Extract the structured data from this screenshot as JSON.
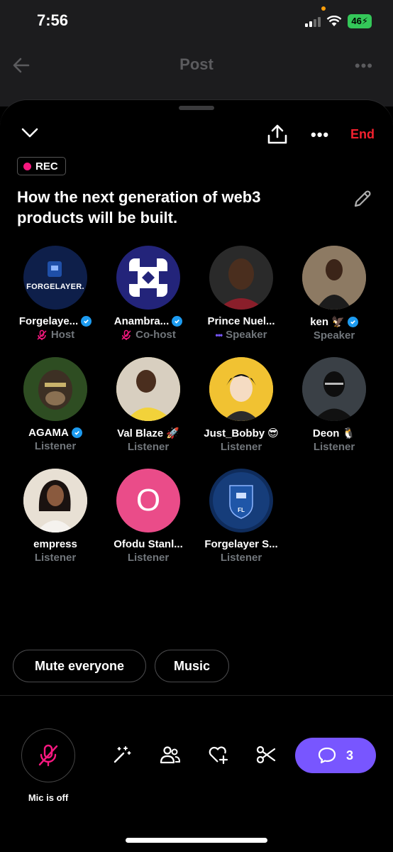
{
  "status": {
    "time": "7:56",
    "battery": "46"
  },
  "post_header": {
    "title": "Post"
  },
  "sheet": {
    "end_label": "End",
    "rec_label": "REC",
    "space_title": "How the next generation of web3 products will be built."
  },
  "participants": [
    {
      "name": "Forgelaye...",
      "role": "Host",
      "verified": true,
      "muted": true
    },
    {
      "name": "Anambra...",
      "role": "Co-host",
      "verified": true,
      "muted": true
    },
    {
      "name": "Prince Nuel...",
      "role": "Speaker",
      "verified": false,
      "speaking_dots": true
    },
    {
      "name": "ken",
      "role": "Speaker",
      "verified": true,
      "emoji": "🦅"
    },
    {
      "name": "AGAMA",
      "role": "Listener",
      "verified": true
    },
    {
      "name": "Val Blaze",
      "role": "Listener",
      "verified": false,
      "emoji": "🚀"
    },
    {
      "name": "Just_Bobby",
      "role": "Listener",
      "verified": false,
      "emoji": "😎"
    },
    {
      "name": "Deon",
      "role": "Listener",
      "verified": false,
      "emoji": "🐧"
    },
    {
      "name": "empress",
      "role": "Listener",
      "verified": false
    },
    {
      "name": "Ofodu Stanl...",
      "role": "Listener",
      "verified": false,
      "initial": "O"
    },
    {
      "name": "Forgelayer S...",
      "role": "Listener",
      "verified": false
    }
  ],
  "logo_text": {
    "forgelayer": "FORGELAYER.",
    "fl": "FL"
  },
  "chips": {
    "mute": "Mute everyone",
    "music": "Music"
  },
  "toolbar": {
    "mic_label": "Mic is off",
    "replies_count": "3"
  },
  "colors": {
    "accent_purple": "#7856ff",
    "end_red": "#f4212e",
    "rec_pink": "#f91880",
    "verified_blue": "#1d9bf0",
    "ofodu_avatar": "#ea4c89"
  }
}
